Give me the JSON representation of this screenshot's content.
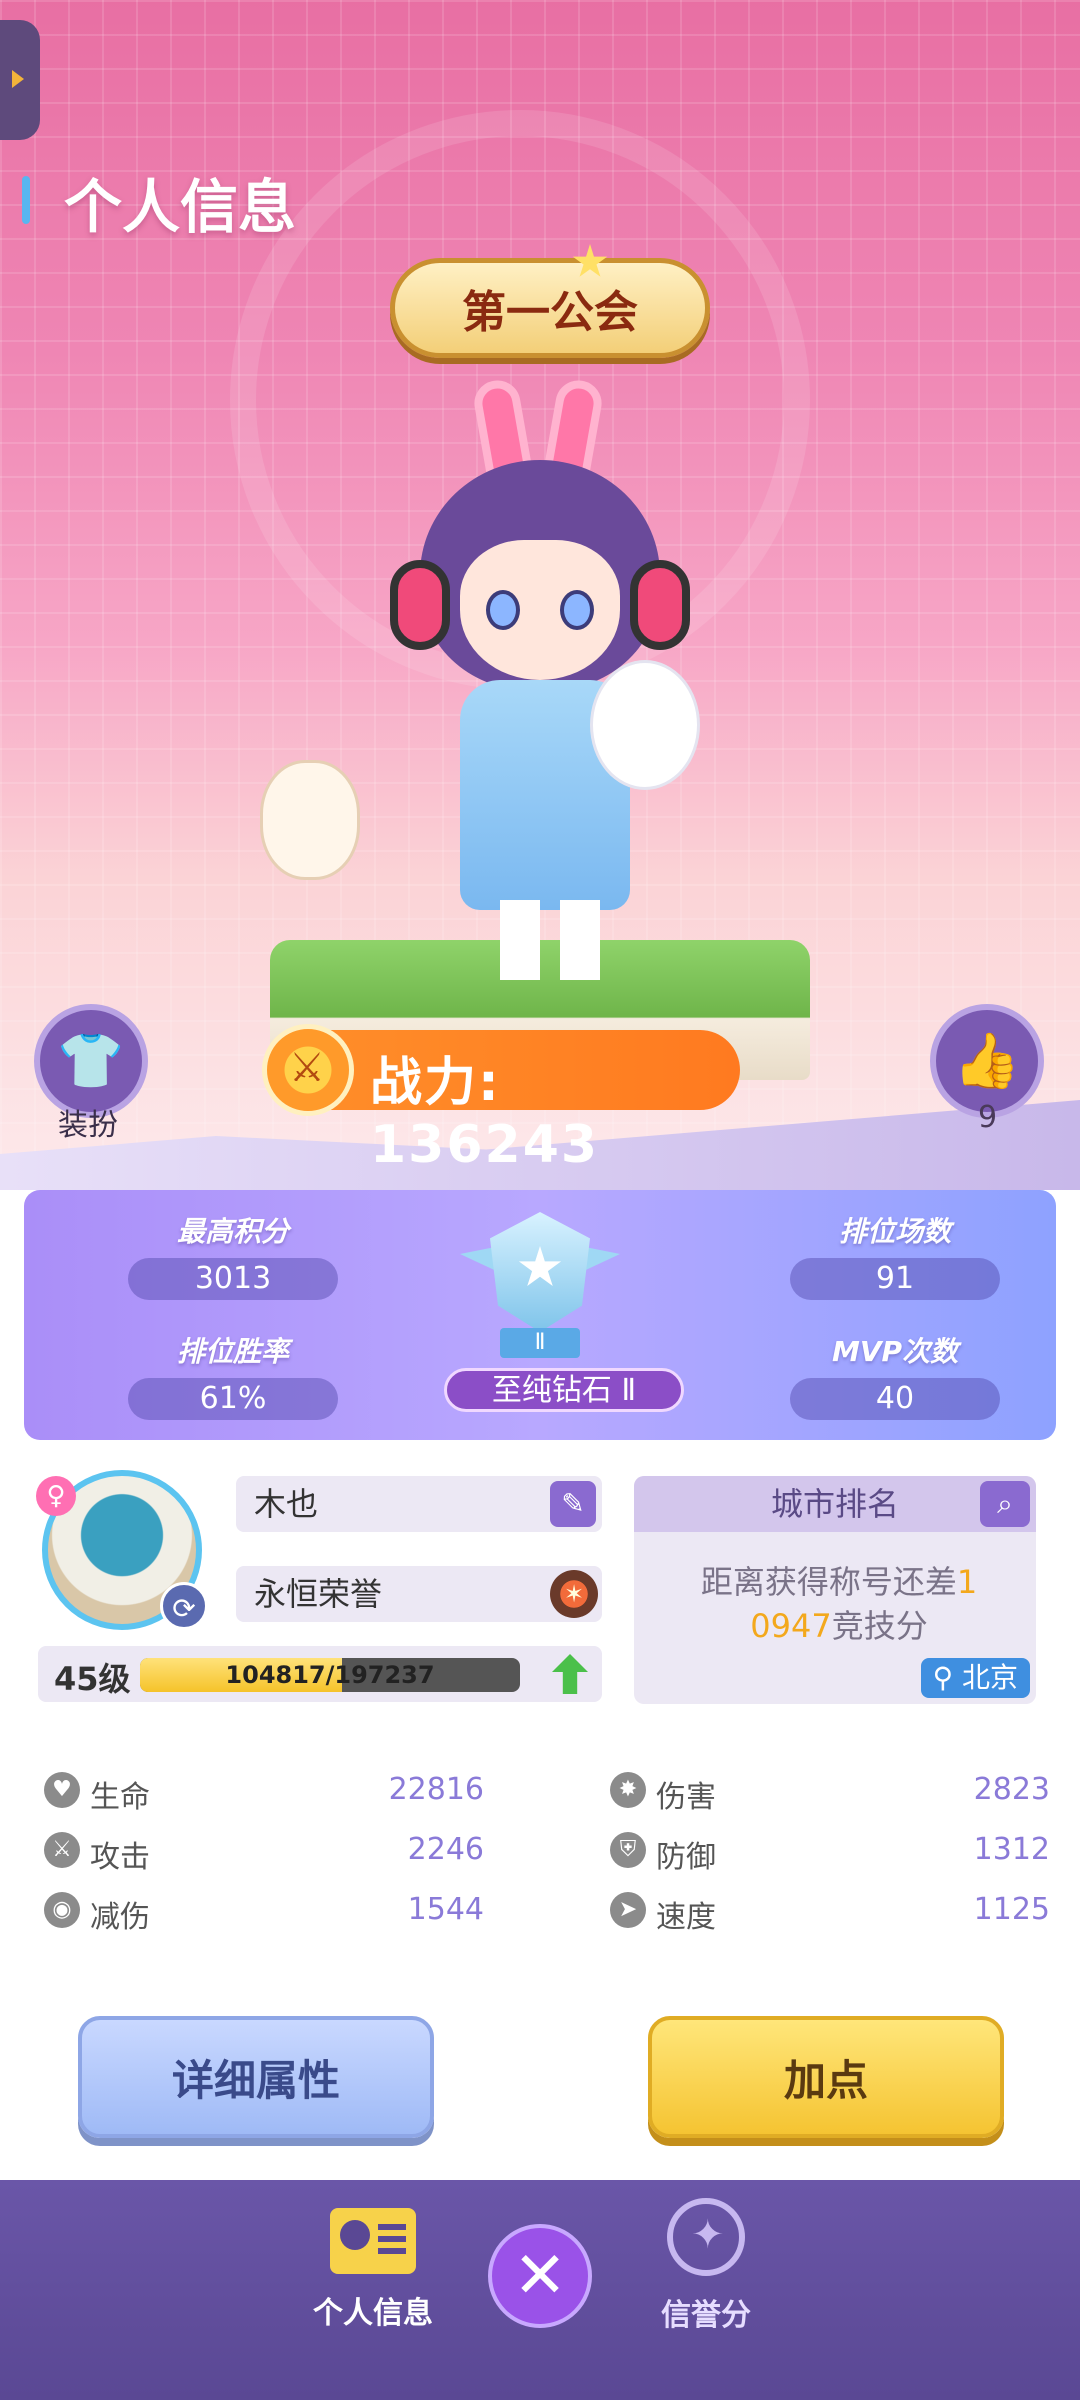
{
  "page": {
    "title": "个人信息"
  },
  "guild": {
    "name": "第一公会"
  },
  "power": {
    "text": "战力: 136243"
  },
  "actions_top": {
    "outfit_label": "装扮",
    "like_count": "9"
  },
  "rank": {
    "highest_score_label": "最高积分",
    "highest_score": "3013",
    "rank_matches_label": "排位场数",
    "rank_matches": "91",
    "win_rate_label": "排位胜率",
    "win_rate": "61%",
    "mvp_label": "MVP次数",
    "mvp_count": "40",
    "tier": "至纯钻石 Ⅱ",
    "tier_roman": "Ⅱ"
  },
  "profile": {
    "name": "木也",
    "honor_title": "永恒荣誉",
    "level": "45级",
    "exp_text": "104817/197237",
    "exp_fraction": 0.531,
    "gender_symbol": "♀"
  },
  "city_rank": {
    "title": "城市排名",
    "message_part1": "距离获得称号还差",
    "message_highlight1": "1",
    "message_highlight2": "0947",
    "message_part2": "竞技分",
    "location": "北京"
  },
  "stats": [
    {
      "label": "生命",
      "value": "22816",
      "icon": "heart-icon"
    },
    {
      "label": "伤害",
      "value": "2823",
      "icon": "damage-icon"
    },
    {
      "label": "攻击",
      "value": "2246",
      "icon": "sword-icon"
    },
    {
      "label": "防御",
      "value": "1312",
      "icon": "shield-icon"
    },
    {
      "label": "减伤",
      "value": "1544",
      "icon": "damage-reduction-icon"
    },
    {
      "label": "速度",
      "value": "1125",
      "icon": "speed-icon"
    }
  ],
  "buttons": {
    "detail": "详细属性",
    "add_point": "加点"
  },
  "nav": {
    "profile_label": "个人信息",
    "credit_label": "信誉分",
    "close_symbol": "✕"
  },
  "colors": {
    "accent_purple": "#8a6ad0",
    "gold": "#f5c432",
    "highlight": "#f3a81c"
  }
}
